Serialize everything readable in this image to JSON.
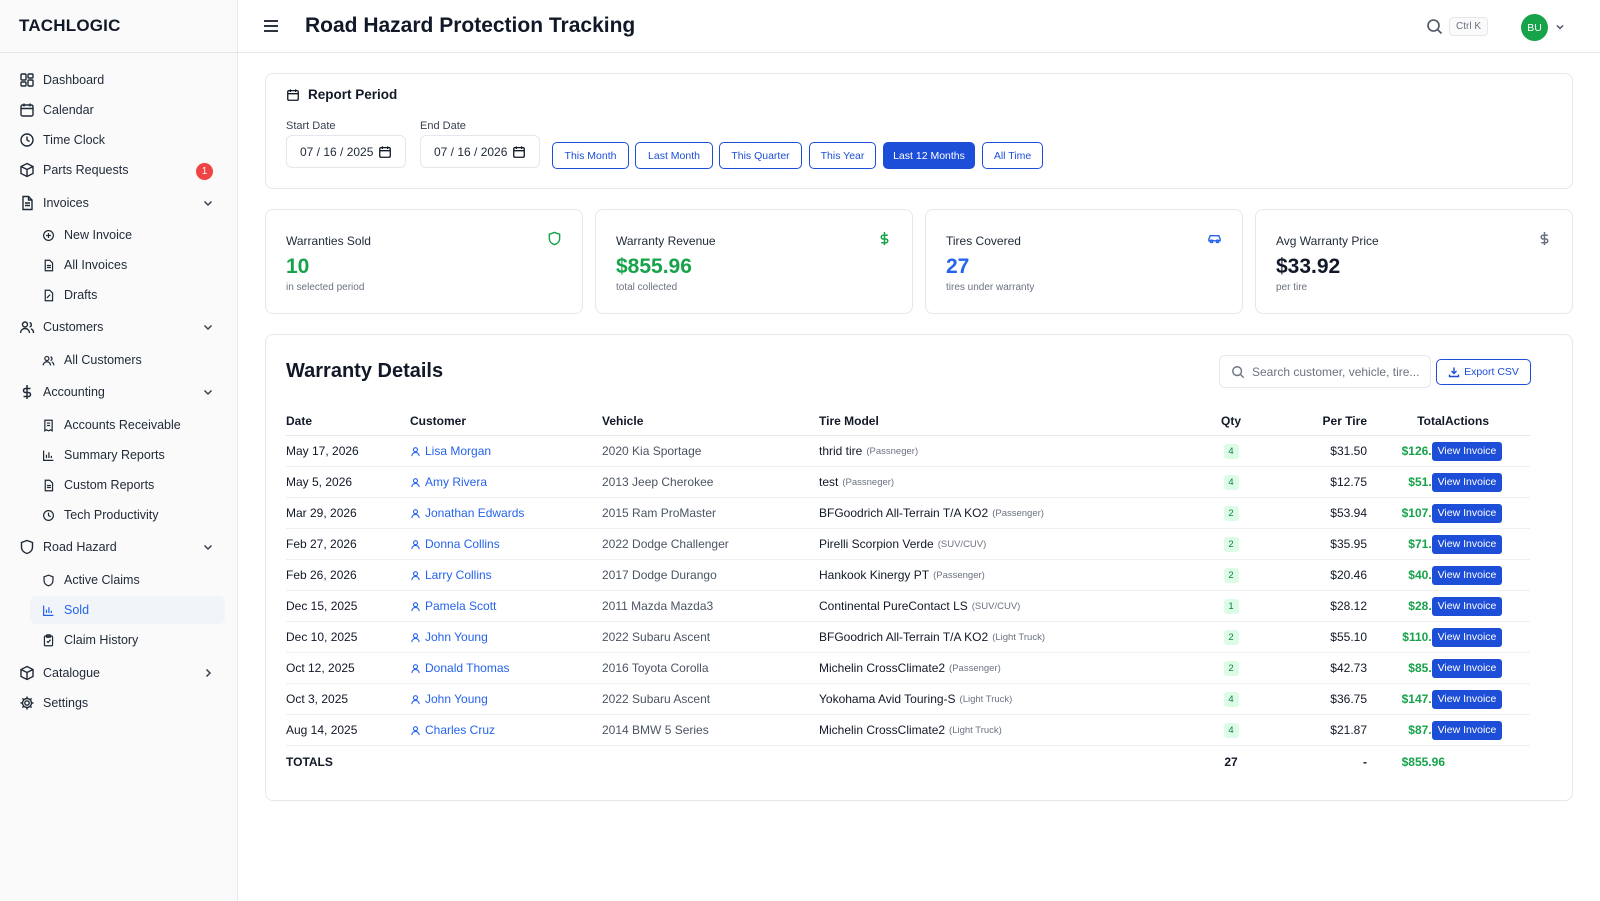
{
  "brand": "TACHLOGIC",
  "topbar": {
    "title": "Road Hazard Protection Tracking",
    "shortcut": "Ctrl K",
    "avatar_initials": "BU"
  },
  "sidebar": {
    "items": [
      {
        "label": "Dashboard",
        "icon": "dashboard-icon"
      },
      {
        "label": "Calendar",
        "icon": "calendar-icon"
      },
      {
        "label": "Time Clock",
        "icon": "clock-icon"
      },
      {
        "label": "Parts Requests",
        "icon": "box-icon",
        "badge": "1"
      },
      {
        "label": "Invoices",
        "icon": "file-icon"
      },
      {
        "label": "New Invoice",
        "icon": "plus-circle-icon"
      },
      {
        "label": "All Invoices",
        "icon": "file-icon"
      },
      {
        "label": "Drafts",
        "icon": "draft-icon"
      },
      {
        "label": "Customers",
        "icon": "users-icon"
      },
      {
        "label": "All Customers",
        "icon": "users-icon"
      },
      {
        "label": "Accounting",
        "icon": "dollar-icon"
      },
      {
        "label": "Accounts Receivable",
        "icon": "receipt-icon"
      },
      {
        "label": "Summary Reports",
        "icon": "bar-chart-icon"
      },
      {
        "label": "Custom Reports",
        "icon": "file-icon"
      },
      {
        "label": "Tech Productivity",
        "icon": "clock-icon"
      },
      {
        "label": "Road Hazard",
        "icon": "shield-icon"
      },
      {
        "label": "Active Claims",
        "icon": "shield-icon"
      },
      {
        "label": "Sold",
        "icon": "bar-chart-icon"
      },
      {
        "label": "Claim History",
        "icon": "clipboard-icon"
      },
      {
        "label": "Catalogue",
        "icon": "box-icon"
      },
      {
        "label": "Settings",
        "icon": "gear-icon"
      }
    ]
  },
  "report_period": {
    "title": "Report Period",
    "start_label": "Start Date",
    "start_value": "07 / 16 / 2025",
    "end_label": "End Date",
    "end_value": "07 / 16 / 2026",
    "ranges": [
      "This Month",
      "Last Month",
      "This Quarter",
      "This Year",
      "Last 12 Months",
      "All Time"
    ],
    "active_range": "Last 12 Months"
  },
  "stats": [
    {
      "label": "Warranties Sold",
      "value": "10",
      "sub": "in selected period",
      "color": "#16a34a",
      "icon": "shield-icon"
    },
    {
      "label": "Warranty Revenue",
      "value": "$855.96",
      "sub": "total collected",
      "color": "#16a34a",
      "icon": "dollar-icon"
    },
    {
      "label": "Tires Covered",
      "value": "27",
      "sub": "tires under warranty",
      "color": "#2563eb",
      "icon": "car-icon"
    },
    {
      "label": "Avg Warranty Price",
      "value": "$33.92",
      "sub": "per tire",
      "color": "#111827",
      "icon": "dollar-icon"
    }
  ],
  "details": {
    "title": "Warranty Details",
    "search_placeholder": "Search customer, vehicle, tire...",
    "export_label": "Export CSV",
    "columns": [
      "Date",
      "Customer",
      "Vehicle",
      "Tire Model",
      "Qty",
      "Per Tire",
      "Total",
      "Actions"
    ],
    "action_label": "View Invoice",
    "rows": [
      {
        "date": "May 17, 2026",
        "customer": "Lisa Morgan",
        "vehicle": "2020 Kia Sportage",
        "tire": "thrid tire",
        "category": "(Passneger)",
        "qty": "4",
        "per_tire": "$31.50",
        "total": "$126.00"
      },
      {
        "date": "May 5, 2026",
        "customer": "Amy Rivera",
        "vehicle": "2013 Jeep Cherokee",
        "tire": "test",
        "category": "(Passneger)",
        "qty": "4",
        "per_tire": "$12.75",
        "total": "$51.00"
      },
      {
        "date": "Mar 29, 2026",
        "customer": "Jonathan Edwards",
        "vehicle": "2015 Ram ProMaster",
        "tire": "BFGoodrich All-Terrain T/A KO2",
        "category": "(Passenger)",
        "qty": "2",
        "per_tire": "$53.94",
        "total": "$107.88"
      },
      {
        "date": "Feb 27, 2026",
        "customer": "Donna Collins",
        "vehicle": "2022 Dodge Challenger",
        "tire": "Pirelli Scorpion Verde",
        "category": "(SUV/CUV)",
        "qty": "2",
        "per_tire": "$35.95",
        "total": "$71.90"
      },
      {
        "date": "Feb 26, 2026",
        "customer": "Larry Collins",
        "vehicle": "2017 Dodge Durango",
        "tire": "Hankook Kinergy PT",
        "category": "(Passenger)",
        "qty": "2",
        "per_tire": "$20.46",
        "total": "$40.92"
      },
      {
        "date": "Dec 15, 2025",
        "customer": "Pamela Scott",
        "vehicle": "2011 Mazda Mazda3",
        "tire": "Continental PureContact LS",
        "category": "(SUV/CUV)",
        "qty": "1",
        "per_tire": "$28.12",
        "total": "$28.12"
      },
      {
        "date": "Dec 10, 2025",
        "customer": "John Young",
        "vehicle": "2022 Subaru Ascent",
        "tire": "BFGoodrich All-Terrain T/A KO2",
        "category": "(Light Truck)",
        "qty": "2",
        "per_tire": "$55.10",
        "total": "$110.20"
      },
      {
        "date": "Oct 12, 2025",
        "customer": "Donald Thomas",
        "vehicle": "2016 Toyota Corolla",
        "tire": "Michelin CrossClimate2",
        "category": "(Passenger)",
        "qty": "2",
        "per_tire": "$42.73",
        "total": "$85.46"
      },
      {
        "date": "Oct 3, 2025",
        "customer": "John Young",
        "vehicle": "2022 Subaru Ascent",
        "tire": "Yokohama Avid Touring-S",
        "category": "(Light Truck)",
        "qty": "4",
        "per_tire": "$36.75",
        "total": "$147.00"
      },
      {
        "date": "Aug 14, 2025",
        "customer": "Charles Cruz",
        "vehicle": "2014 BMW 5 Series",
        "tire": "Michelin CrossClimate2",
        "category": "(Light Truck)",
        "qty": "4",
        "per_tire": "$21.87",
        "total": "$87.48"
      }
    ],
    "totals": {
      "label": "TOTALS",
      "qty": "27",
      "per_tire": "-",
      "total": "$855.96"
    }
  }
}
